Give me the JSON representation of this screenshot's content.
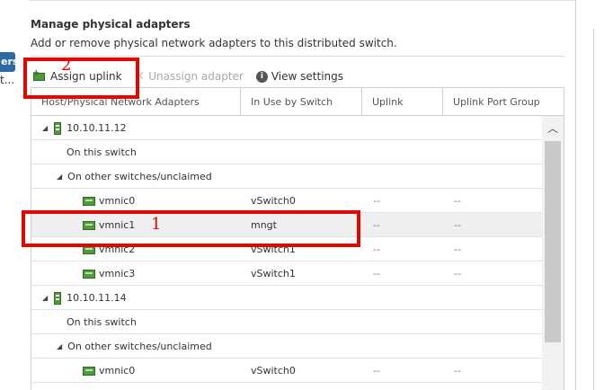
{
  "left_panel": {
    "badge_text": "ers",
    "ellipsis_text": "t..."
  },
  "section": {
    "title": "Manage physical adapters",
    "description": "Add or remove physical network adapters to this distributed switch."
  },
  "toolbar": {
    "assign_label": "Assign uplink",
    "unassign_label": "Unassign adapter",
    "view_settings_label": "View settings",
    "icons": {
      "assign": "add-nic-icon",
      "unassign": "remove-x-icon",
      "view": "info-icon"
    }
  },
  "grid": {
    "columns": [
      "Host/Physical Network Adapters",
      "In Use by Switch",
      "Uplink",
      "Uplink Port Group"
    ],
    "rows": [
      {
        "type": "host",
        "name": "10.10.11.12"
      },
      {
        "type": "group",
        "name": "On this switch"
      },
      {
        "type": "group-expand",
        "name": "On other switches/unclaimed"
      },
      {
        "type": "nic",
        "name": "vmnic0",
        "switch": "vSwitch0",
        "uplink": "--",
        "portgroup": "--"
      },
      {
        "type": "nic",
        "name": "vmnic1",
        "switch": "mngt",
        "uplink": "--",
        "portgroup": "--",
        "selected": true
      },
      {
        "type": "nic",
        "name": "vmnic2",
        "switch": "vSwitch1",
        "uplink": "--",
        "portgroup": "--"
      },
      {
        "type": "nic",
        "name": "vmnic3",
        "switch": "vSwitch1",
        "uplink": "--",
        "portgroup": "--"
      },
      {
        "type": "host",
        "name": "10.10.11.14"
      },
      {
        "type": "group",
        "name": "On this switch"
      },
      {
        "type": "group-expand",
        "name": "On other switches/unclaimed"
      },
      {
        "type": "nic",
        "name": "vmnic0",
        "switch": "vSwitch0",
        "uplink": "--",
        "portgroup": "--"
      },
      {
        "type": "nic",
        "name": "",
        "switch": "",
        "uplink": "",
        "portgroup": ""
      }
    ]
  },
  "annotations": [
    {
      "number": "1"
    },
    {
      "number": "2"
    }
  ],
  "colors": {
    "annotation": "#e10600",
    "selected_row": "#efefef",
    "nic_icon": "#4f9a3e"
  }
}
